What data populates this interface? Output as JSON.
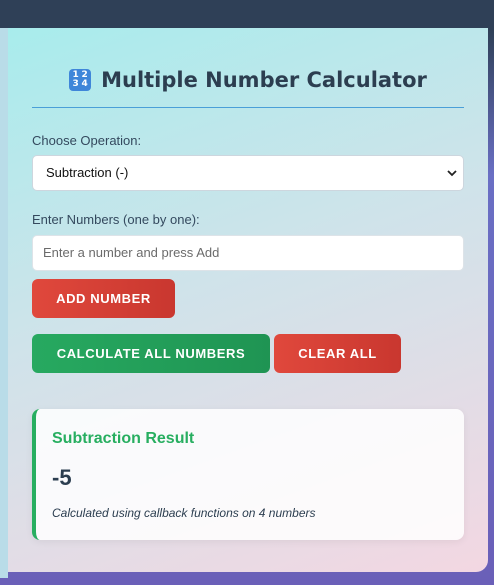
{
  "app": {
    "title": "Multiple Number Calculator",
    "title_icon_digits": [
      "1",
      "2",
      "3",
      "4"
    ]
  },
  "operation": {
    "label": "Choose Operation:",
    "selected": "Subtraction (-)"
  },
  "numbers": {
    "label": "Enter Numbers (one by one):",
    "placeholder": "Enter a number and press Add"
  },
  "buttons": {
    "add": "Add Number",
    "calculate": "Calculate All Numbers",
    "clear": "Clear All"
  },
  "result": {
    "title": "Subtraction Result",
    "value": "-5",
    "note": "Calculated using callback functions on 4 numbers"
  },
  "colors": {
    "accent_green": "#27ae60",
    "accent_red": "#e0483c",
    "title_text": "#2c3e50",
    "divider": "#4a9fd8"
  }
}
